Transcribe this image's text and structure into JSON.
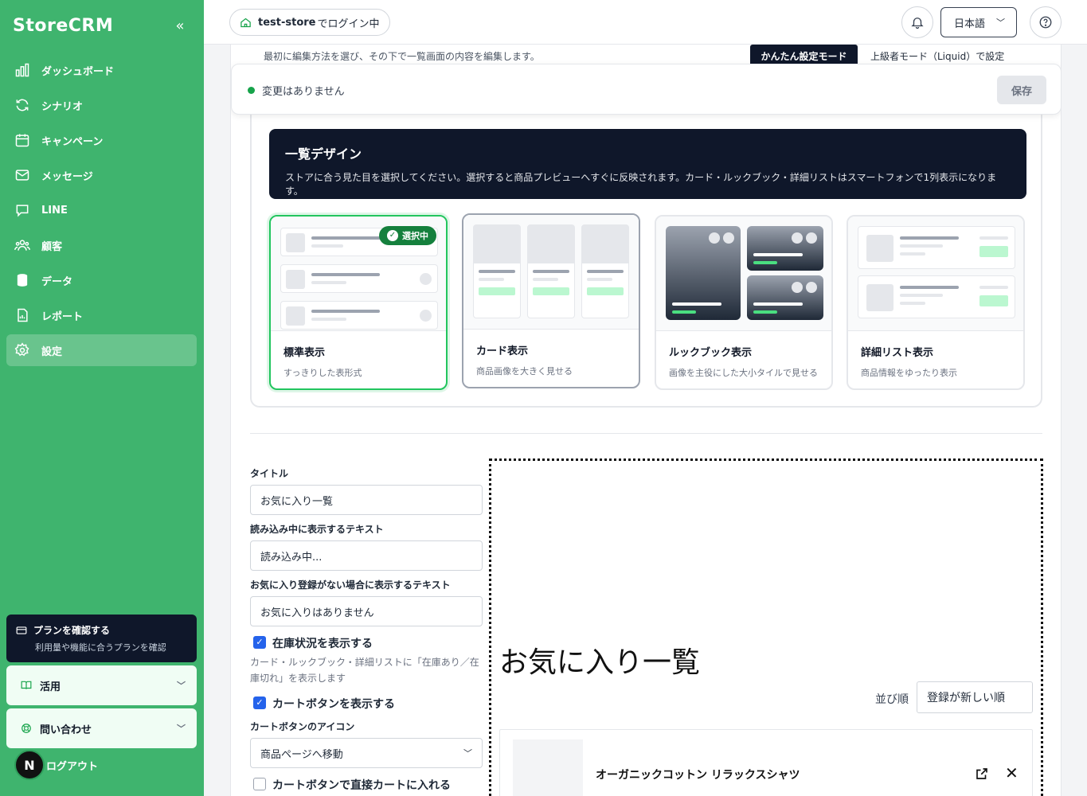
{
  "app": {
    "brand": "StoreCRM"
  },
  "sidebar": {
    "items": [
      {
        "label": "ダッシュボード",
        "icon": "chart-icon"
      },
      {
        "label": "シナリオ",
        "icon": "refresh-icon"
      },
      {
        "label": "キャンペーン",
        "icon": "calendar-icon"
      },
      {
        "label": "メッセージ",
        "icon": "mail-icon"
      },
      {
        "label": "LINE",
        "icon": "chat-icon"
      },
      {
        "label": "顧客",
        "icon": "users-icon"
      },
      {
        "label": "データ",
        "icon": "database-icon"
      },
      {
        "label": "レポート",
        "icon": "report-icon"
      },
      {
        "label": "設定",
        "icon": "gear-icon",
        "active": true
      }
    ],
    "plan": {
      "title": "プランを確認する",
      "subtitle": "利用量や機能に合うプランを確認"
    },
    "accordion": [
      {
        "label": "活用"
      },
      {
        "label": "問い合わせ"
      }
    ],
    "avatar": "N",
    "logout": "ログアウト"
  },
  "topbar": {
    "store": "test-store",
    "store_suffix": "でログイン中",
    "language": "日本語"
  },
  "editor": {
    "intro": "最初に編集方法を選び、その下で一覧画面の内容を編集します。",
    "mode_simple": "かんたん設定モード",
    "mode_advanced": "上級者モード（Liquid）で設定",
    "status": "変更はありません",
    "save": "保存"
  },
  "design": {
    "title": "一覧デザイン",
    "description": "ストアに合う見た目を選択してください。選択すると商品プレビューへすぐに反映されます。カード・ルックブック・詳細リストはスマートフォンで1列表示になります。",
    "selected_badge": "選択中",
    "options": [
      {
        "name": "標準表示",
        "desc": "すっきりした表形式"
      },
      {
        "name": "カード表示",
        "desc": "商品画像を大きく見せる"
      },
      {
        "name": "ルックブック表示",
        "desc": "画像を主役にした大小タイルで見せる"
      },
      {
        "name": "詳細リスト表示",
        "desc": "商品情報をゆったり表示"
      }
    ]
  },
  "form": {
    "title_label": "タイトル",
    "title_value": "お気に入り一覧",
    "loading_label": "読み込み中に表示するテキスト",
    "loading_value": "読み込み中...",
    "empty_label": "お気に入り登録がない場合に表示するテキスト",
    "empty_value": "お気に入りはありません",
    "stock_label": "在庫状況を表示する",
    "stock_help": "カード・ルックブック・詳細リストに「在庫あり／在庫切れ」を表示します",
    "cart_label": "カートボタンを表示する",
    "cart_icon_label": "カートボタンのアイコン",
    "cart_icon_value": "商品ページへ移動",
    "direct_cart_label": "カートボタンで直接カートに入れる"
  },
  "preview": {
    "title": "お気に入り一覧",
    "sort_label": "並び順",
    "sort_value": "登録が新しい順",
    "item_name": "オーガニックコットン リラックスシャツ"
  }
}
